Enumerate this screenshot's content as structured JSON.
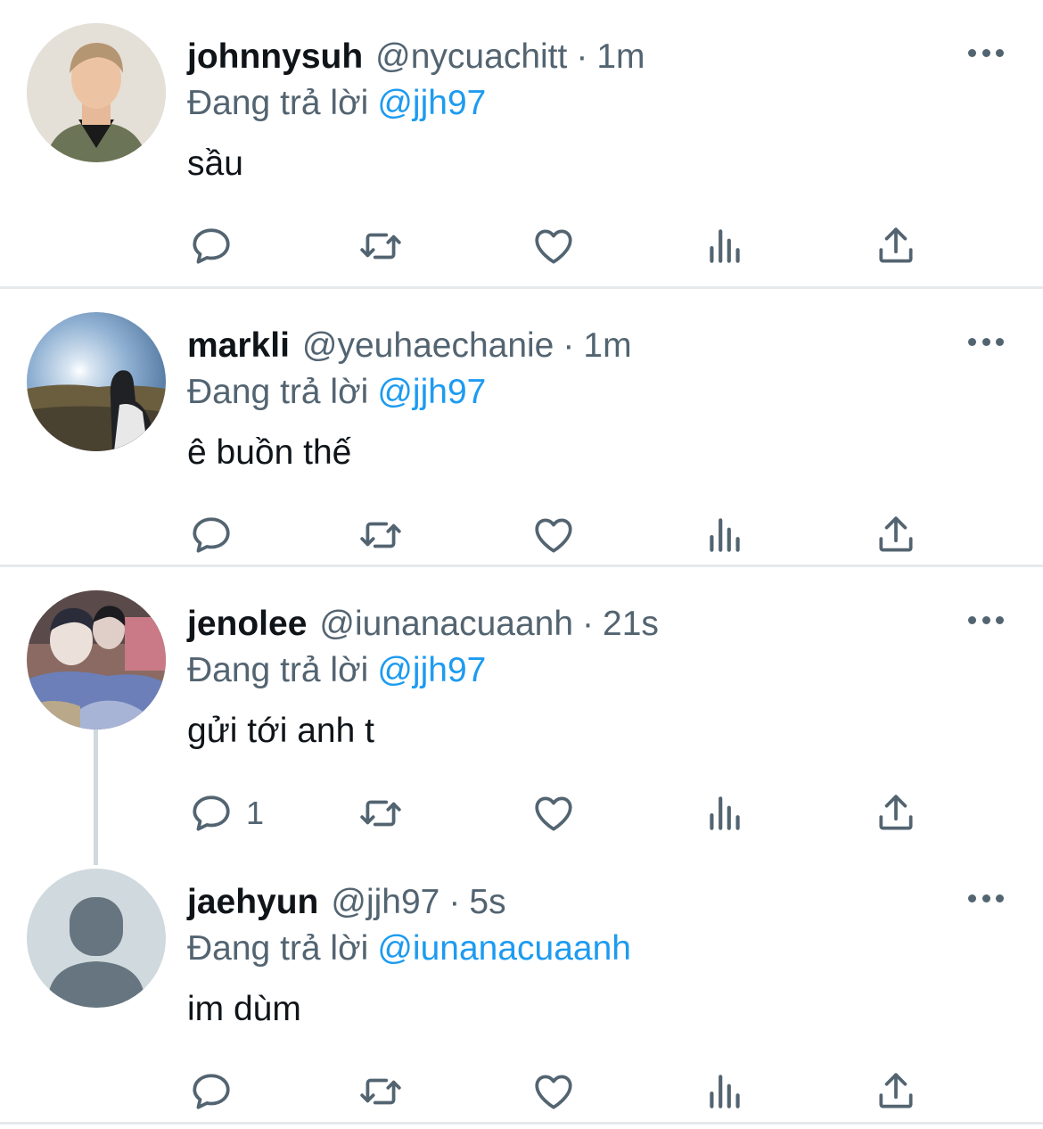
{
  "replying_label": "Đang trả lời",
  "tweets": [
    {
      "name": "johnnysuh",
      "handle": "@nycuachitt",
      "separator": "·",
      "time": "1m",
      "reply_to": "@jjh97",
      "text": "sầu",
      "reply_count": ""
    },
    {
      "name": "markli",
      "handle": "@yeuhaechanie",
      "separator": "·",
      "time": "1m",
      "reply_to": "@jjh97",
      "text": "ê buồn thế",
      "reply_count": ""
    },
    {
      "name": "jenolee",
      "handle": "@iunanacuaanh",
      "separator": "·",
      "time": "21s",
      "reply_to": "@jjh97",
      "text": "gửi tới anh t",
      "reply_count": "1"
    },
    {
      "name": "jaehyun",
      "handle": "@jjh97",
      "separator": "·",
      "time": "5s",
      "reply_to": "@iunanacuaanh",
      "text": "im dùm",
      "reply_count": ""
    }
  ],
  "colors": {
    "link": "#1d9bf0",
    "secondary_text": "#536471",
    "primary_text": "#0f1419",
    "divider": "#e6e9ec"
  },
  "icons": {
    "reply": "reply-icon",
    "retweet": "retweet-icon",
    "like": "like-icon",
    "views": "views-icon",
    "share": "share-icon",
    "more": "more-icon"
  }
}
